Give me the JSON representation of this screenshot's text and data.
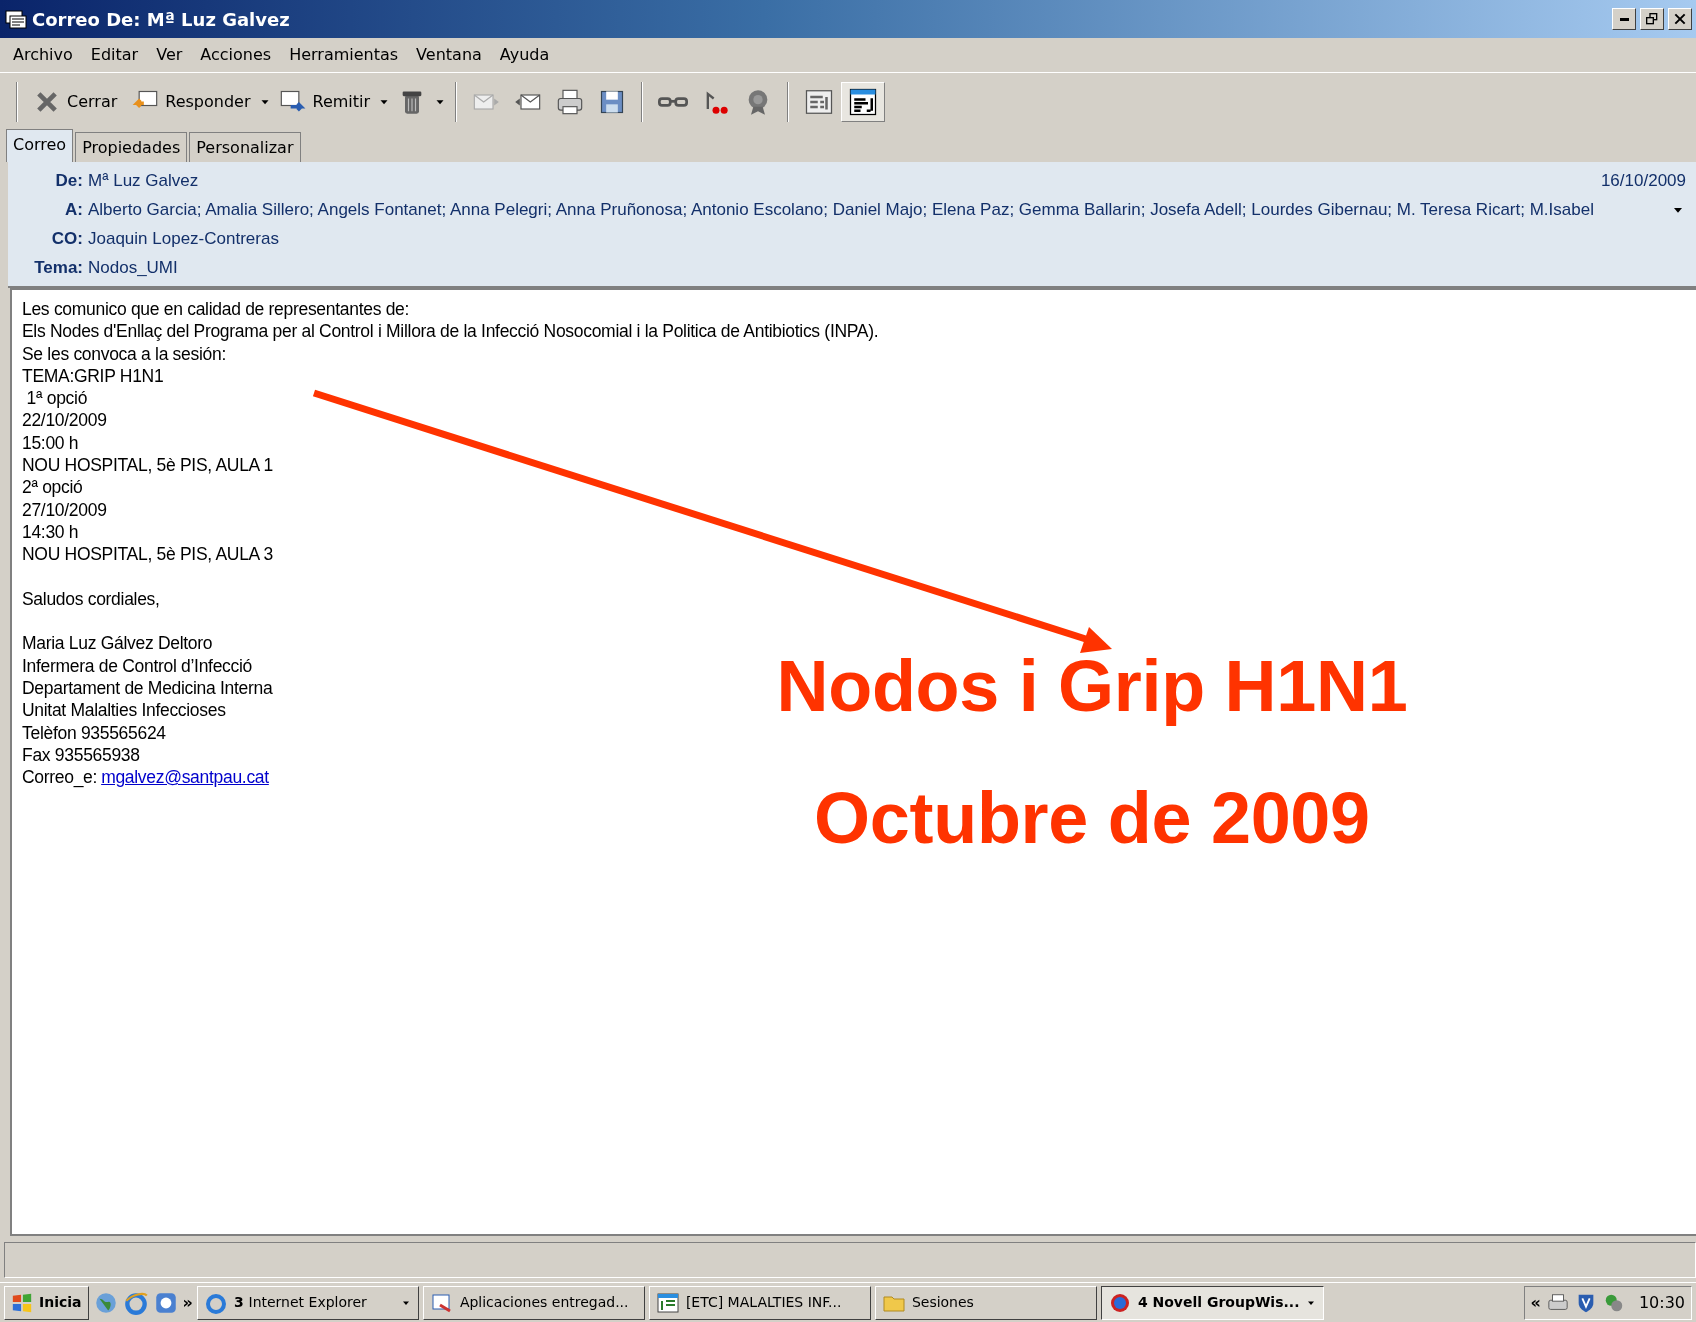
{
  "window": {
    "title": "Correo De: Mª Luz Galvez"
  },
  "menu": [
    "Archivo",
    "Editar",
    "Ver",
    "Acciones",
    "Herramientas",
    "Ventana",
    "Ayuda"
  ],
  "toolbar": [
    {
      "label": "Cerrar",
      "dropdown": false
    },
    {
      "label": "Responder",
      "dropdown": true
    },
    {
      "label": "Remitir",
      "dropdown": true
    },
    {
      "dropdown": true
    },
    {
      "dropdown": false
    },
    {
      "dropdown": false
    },
    {
      "dropdown": false
    },
    {
      "dropdown": false
    },
    {
      "dropdown": false
    },
    {
      "dropdown": false
    },
    {
      "dropdown": false
    }
  ],
  "view_buttons": [
    {
      "selected": false
    },
    {
      "selected": true
    }
  ],
  "tabs": [
    {
      "label": "Correo",
      "selected": true
    },
    {
      "label": "Propiedades",
      "selected": false
    },
    {
      "label": "Personalizar",
      "selected": false
    }
  ],
  "header": {
    "from_label": "De:",
    "from": "Mª Luz Galvez",
    "date": "16/10/2009",
    "to_label": "A:",
    "to": "Alberto Garcia; Amalia Sillero; Angels Fontanet; Anna Pelegri; Anna Pruñonosa; Antonio Escolano; Daniel Majo; Elena Paz; Gemma Ballarin; Josefa Adell; Lourdes Gibernau; M. Teresa Ricart; M.Isabel",
    "cc_label": "CO:",
    "cc": "Joaquin Lopez-Contreras",
    "subject_label": "Tema:",
    "subject": "Nodos_UMI"
  },
  "body": [
    {
      "lines": [
        "Les comunico que en calidad de representantes de:",
        "Els Nodes d'Enllaç del Programa per al Control i Millora de la Infecció Nosocomial i la Politica de Antibiotics (INPA).",
        "Se les convoca a la sesión:",
        "TEMA:GRIP H1N1",
        " 1ª opció",
        "22/10/2009",
        "15:00 h",
        "NOU HOSPITAL, 5è PIS, AULA 1",
        "2ª opció",
        "27/10/2009",
        "14:30 h",
        "NOU HOSPITAL, 5è PIS, AULA 3"
      ]
    },
    {
      "lines": [
        "Saludos cordiales,"
      ]
    },
    {
      "lines": [
        "Maria Luz Gálvez Deltoro",
        "Infermera de Control d’Infecció",
        "Departament de Medicina Interna",
        "Unitat Malalties Infeccioses",
        "Telèfon 935565624",
        "Fax 935565938"
      ],
      "email_label": "Correo_e:",
      "email": "mgalvez@santpau.cat"
    }
  ],
  "annotation": {
    "title": "Nodos i Grip H1N1",
    "subtitle": "Octubre de 2009"
  },
  "taskbar": {
    "start": "Inicia",
    "more": "»",
    "tasks": [
      {
        "count": "3",
        "label": "Internet Explorer",
        "dropdown": true,
        "selected": false
      },
      {
        "label": "Aplicaciones entregad...",
        "dropdown": false,
        "selected": false
      },
      {
        "label": "[ETC] MALALTIES INF...",
        "dropdown": false,
        "selected": false
      },
      {
        "label": "Sesiones",
        "dropdown": false,
        "selected": false
      },
      {
        "count": "4",
        "label": "Novell GroupWis...",
        "dropdown": true,
        "selected": true
      }
    ],
    "tray_toggle": "«",
    "clock": "10:30"
  }
}
